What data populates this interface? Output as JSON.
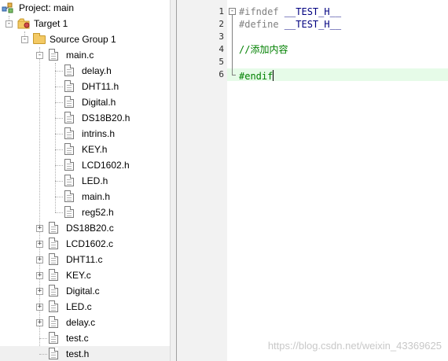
{
  "project": {
    "title": "Project: main",
    "target": "Target 1",
    "group": "Source Group 1",
    "main_file": "main.c",
    "includes": [
      "delay.h",
      "DHT11.h",
      "Digital.h",
      "DS18B20.h",
      "intrins.h",
      "KEY.h",
      "LCD1602.h",
      "LED.h",
      "main.h",
      "reg52.h"
    ],
    "source_files": [
      "DS18B20.c",
      "LCD1602.c",
      "DHT11.c",
      "KEY.c",
      "Digital.c",
      "LED.c",
      "delay.c"
    ],
    "plain_files": [
      "test.c",
      "test.h"
    ],
    "selected_file": "test.h"
  },
  "editor": {
    "line_numbers": [
      "1",
      "2",
      "3",
      "4",
      "5",
      "6"
    ],
    "lines": [
      {
        "kw": "#ifndef",
        "rest": " __TEST_H__"
      },
      {
        "kw": "#define",
        "rest": " __TEST_H__"
      },
      {
        "kw": "",
        "rest": ""
      },
      {
        "cmt": "//添加内容"
      },
      {
        "kw": "",
        "rest": ""
      },
      {
        "kw": "#endif",
        "rest": ""
      }
    ],
    "current_line": 6
  },
  "watermark": "https://blog.csdn.net/weixin_43369625",
  "colors": {
    "preprocessor": "#808080",
    "identifier": "#000080",
    "comment": "#008000",
    "current_line_bg": "#e6fbe8",
    "gutter_bg": "#f2f2f2"
  },
  "icons": {
    "project": "project-tree-icon",
    "folder": "folder-icon",
    "file": "file-icon",
    "expand": "expand-plus-icon",
    "collapse": "collapse-minus-icon"
  }
}
